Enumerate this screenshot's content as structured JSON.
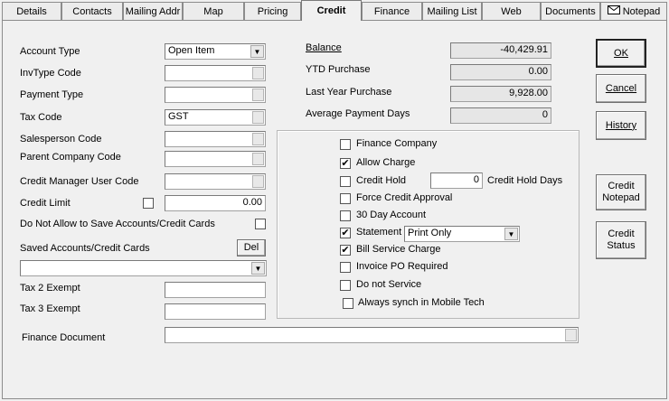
{
  "tabs": [
    {
      "label": "Details"
    },
    {
      "label": "Contacts"
    },
    {
      "label": "Mailing Addr"
    },
    {
      "label": "Map"
    },
    {
      "label": "Pricing"
    },
    {
      "label": "Credit"
    },
    {
      "label": "Finance"
    },
    {
      "label": "Mailing List"
    },
    {
      "label": "Web"
    },
    {
      "label": "Documents"
    },
    {
      "label": "Notepad"
    }
  ],
  "active_tab": "Credit",
  "left": {
    "account_type": {
      "label": "Account Type",
      "value": "Open Item"
    },
    "invtype_code": {
      "label": "InvType Code",
      "value": ""
    },
    "payment_type": {
      "label": "Payment Type",
      "value": ""
    },
    "tax_code": {
      "label": "Tax Code",
      "value": "GST"
    },
    "salesperson_code": {
      "label": "Salesperson Code",
      "value": ""
    },
    "parent_company_code": {
      "label": "Parent Company Code",
      "value": ""
    },
    "credit_manager_user_code": {
      "label": "Credit Manager User Code",
      "value": ""
    },
    "credit_limit": {
      "label": "Credit Limit",
      "value": "0.00",
      "checked": false
    },
    "no_save_accounts": {
      "label": "Do Not Allow to Save Accounts/Credit Cards",
      "checked": false
    },
    "saved_accounts": {
      "label": "Saved Accounts/Credit Cards",
      "del_label": "Del",
      "value": ""
    },
    "tax2_exempt": {
      "label": "Tax 2 Exempt",
      "value": ""
    },
    "tax3_exempt": {
      "label": "Tax 3 Exempt",
      "value": ""
    },
    "finance_document": {
      "label": "Finance Document",
      "value": ""
    }
  },
  "summary": {
    "balance": {
      "label": "Balance",
      "value": "-40,429.91"
    },
    "ytd_purchase": {
      "label": "YTD Purchase",
      "value": "0.00"
    },
    "last_year_purchase": {
      "label": "Last Year Purchase",
      "value": "9,928.00"
    },
    "avg_payment_days": {
      "label": "Average Payment Days",
      "value": "0"
    }
  },
  "options": {
    "finance_company": {
      "label": "Finance Company",
      "checked": false
    },
    "allow_charge": {
      "label": "Allow Charge",
      "checked": true
    },
    "credit_hold": {
      "label": "Credit Hold",
      "checked": false,
      "days_value": "0",
      "days_label": "Credit Hold Days"
    },
    "force_credit_approval": {
      "label": "Force Credit Approval",
      "checked": false
    },
    "day30_account": {
      "label": "30 Day Account",
      "checked": false
    },
    "statement": {
      "label": "Statement",
      "checked": true,
      "value": "Print Only"
    },
    "bill_service_charge": {
      "label": "Bill Service Charge",
      "checked": true
    },
    "invoice_po_required": {
      "label": "Invoice PO Required",
      "checked": false
    },
    "do_not_service": {
      "label": "Do not Service",
      "checked": false
    },
    "always_synch": {
      "label": "Always synch in Mobile Tech",
      "checked": false
    }
  },
  "buttons": {
    "ok": "OK",
    "cancel": "Cancel",
    "history": "History",
    "credit_notepad": "Credit Notepad",
    "credit_status": "Credit Status"
  },
  "icons": {
    "notepad_tab": "envelope-icon",
    "check": "✔",
    "dropdown": "▼"
  }
}
